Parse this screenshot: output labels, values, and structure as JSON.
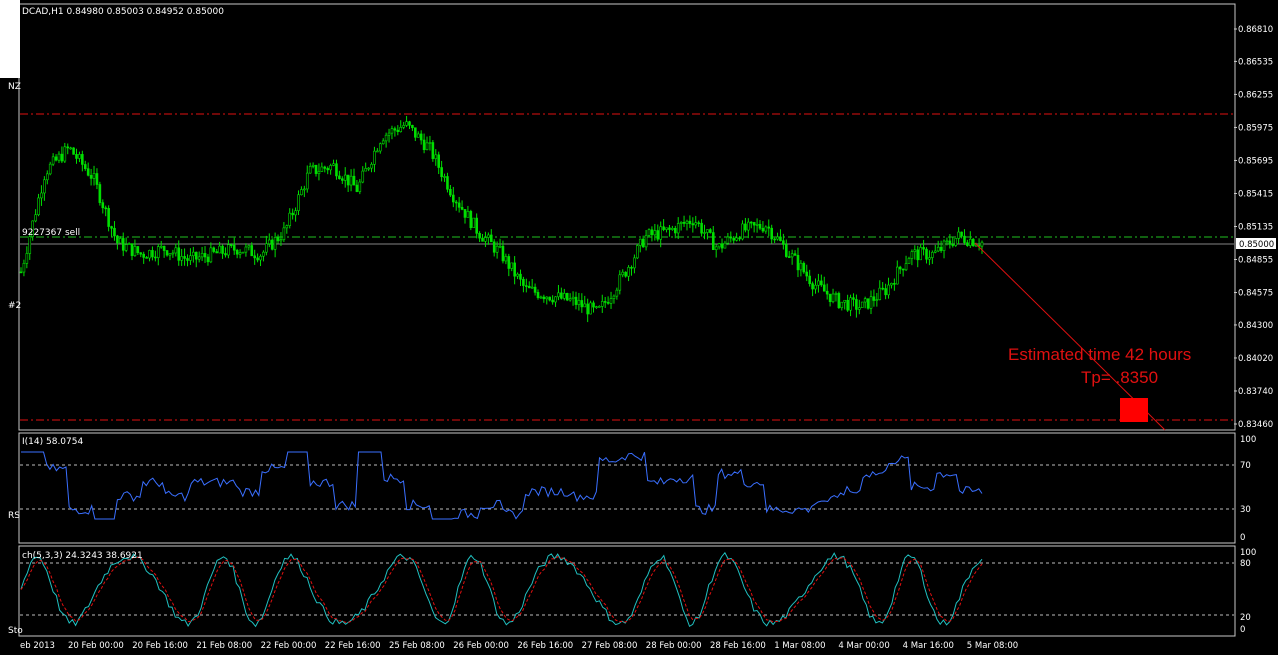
{
  "main_chart": {
    "header": "DCAD,H1  0.84980 0.85003 0.84952 0.85000",
    "order_label": "9227367 sell",
    "left_tags": [
      "NZ",
      "#2"
    ],
    "price_axis": [
      "0.86810",
      "0.86535",
      "0.86255",
      "0.85975",
      "0.85695",
      "0.85415",
      "0.85135",
      "0.84855",
      "0.84575",
      "0.84300",
      "0.84020",
      "0.83740",
      "0.83460"
    ],
    "current_price": "0.85000",
    "annotation_line1": "Estimated time 42 hours",
    "annotation_line2": "Tp= .8350",
    "colors": {
      "candle": "#00e000",
      "resistance": "#e01010",
      "order": "#20c020",
      "target": "#ff0000"
    }
  },
  "rsi_panel": {
    "title": "I(14) 58.0754",
    "left_tag": "RS",
    "axis": [
      "100",
      "70",
      "30",
      "0"
    ],
    "color": "#3a6fff"
  },
  "stoch_panel": {
    "title": "ch(5,3,3) 24.3243 38.6921",
    "left_tag": "Sto",
    "axis": [
      "100",
      "80",
      "20",
      "0"
    ],
    "main_color": "#20c0c0",
    "signal_color": "#e01010"
  },
  "time_axis": [
    "eb 2013",
    "20 Feb 00:00",
    "20 Feb 16:00",
    "21 Feb 08:00",
    "22 Feb 00:00",
    "22 Feb 16:00",
    "25 Feb 08:00",
    "26 Feb 00:00",
    "26 Feb 16:00",
    "27 Feb 08:00",
    "28 Feb 00:00",
    "28 Feb 16:00",
    "1 Mar 08:00",
    "4 Mar 00:00",
    "4 Mar 16:00",
    "5 Mar 08:00"
  ],
  "chart_data": {
    "type": "candlestick",
    "symbol": "DCAD",
    "timeframe": "H1",
    "ohlc_last": {
      "open": 0.8498,
      "high": 0.85003,
      "low": 0.84952,
      "close": 0.85
    },
    "resistance_level": 0.861,
    "support_level": 0.8347,
    "order_level": 0.8505,
    "take_profit": 0.835,
    "close_path": [
      {
        "x": "19 Feb 2013",
        "y": 0.8475
      },
      {
        "x": "19 Feb 2013",
        "y": 0.856
      },
      {
        "x": "19 Feb 2013",
        "y": 0.858
      },
      {
        "x": "19 Feb 2013",
        "y": 0.8555
      },
      {
        "x": "20 Feb 00:00",
        "y": 0.85
      },
      {
        "x": "20 Feb 00:00",
        "y": 0.849
      },
      {
        "x": "20 Feb 16:00",
        "y": 0.8495
      },
      {
        "x": "20 Feb 16:00",
        "y": 0.8485
      },
      {
        "x": "21 Feb 08:00",
        "y": 0.849
      },
      {
        "x": "21 Feb 08:00",
        "y": 0.8495
      },
      {
        "x": "22 Feb 00:00",
        "y": 0.849
      },
      {
        "x": "22 Feb 00:00",
        "y": 0.851
      },
      {
        "x": "22 Feb 00:00",
        "y": 0.856
      },
      {
        "x": "22 Feb 16:00",
        "y": 0.8565
      },
      {
        "x": "22 Feb 16:00",
        "y": 0.8545
      },
      {
        "x": "25 Feb 08:00",
        "y": 0.859
      },
      {
        "x": "25 Feb 08:00",
        "y": 0.86
      },
      {
        "x": "25 Feb 08:00",
        "y": 0.858
      },
      {
        "x": "26 Feb 00:00",
        "y": 0.854
      },
      {
        "x": "26 Feb 00:00",
        "y": 0.851
      },
      {
        "x": "26 Feb 00:00",
        "y": 0.849
      },
      {
        "x": "26 Feb 16:00",
        "y": 0.846
      },
      {
        "x": "26 Feb 16:00",
        "y": 0.8455
      },
      {
        "x": "27 Feb 08:00",
        "y": 0.845
      },
      {
        "x": "27 Feb 08:00",
        "y": 0.844
      },
      {
        "x": "28 Feb 00:00",
        "y": 0.847
      },
      {
        "x": "28 Feb 00:00",
        "y": 0.8505
      },
      {
        "x": "28 Feb 16:00",
        "y": 0.851
      },
      {
        "x": "28 Feb 16:00",
        "y": 0.852
      },
      {
        "x": "28 Feb 16:00",
        "y": 0.8495
      },
      {
        "x": "1 Mar 08:00",
        "y": 0.851
      },
      {
        "x": "1 Mar 08:00",
        "y": 0.8515
      },
      {
        "x": "1 Mar 08:00",
        "y": 0.849
      },
      {
        "x": "4 Mar 00:00",
        "y": 0.8465
      },
      {
        "x": "4 Mar 00:00",
        "y": 0.845
      },
      {
        "x": "4 Mar 00:00",
        "y": 0.8445
      },
      {
        "x": "4 Mar 16:00",
        "y": 0.846
      },
      {
        "x": "4 Mar 16:00",
        "y": 0.849
      },
      {
        "x": "5 Mar 08:00",
        "y": 0.849
      },
      {
        "x": "5 Mar 08:00",
        "y": 0.8505
      },
      {
        "x": "5 Mar 08:00",
        "y": 0.85
      }
    ],
    "ylim": [
      0.8346,
      0.8681
    ],
    "rsi_last": 58.0754,
    "stoch_last": [
      24.3243,
      38.6921
    ]
  }
}
